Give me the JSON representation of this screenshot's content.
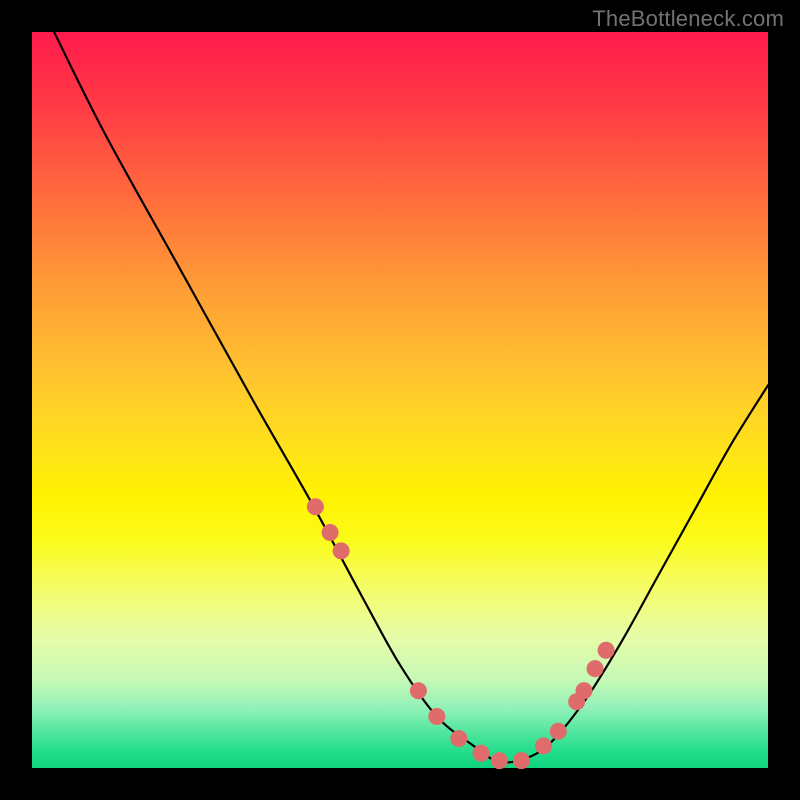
{
  "watermark": "TheBottleneck.com",
  "colors": {
    "frame": "#000000",
    "curve": "#000000",
    "dots": "#e06b6b",
    "watermark": "#737373"
  },
  "chart_data": {
    "type": "line",
    "title": "",
    "xlabel": "",
    "ylabel": "",
    "xlim": [
      0,
      100
    ],
    "ylim": [
      0,
      100
    ],
    "grid": false,
    "legend": false,
    "series": [
      {
        "name": "bottleneck-curve",
        "x": [
          3,
          10,
          20,
          30,
          38,
          45,
          50,
          55,
          60,
          63,
          66,
          70,
          75,
          80,
          85,
          90,
          95,
          100
        ],
        "y": [
          100,
          86,
          68,
          50,
          36,
          23,
          14,
          7,
          3,
          1,
          1,
          3,
          9,
          17,
          26,
          35,
          44,
          52
        ]
      }
    ],
    "dots": {
      "name": "highlight-dots",
      "x": [
        38.5,
        40.5,
        42,
        52.5,
        55,
        58,
        61,
        63.5,
        66.5,
        69.5,
        71.5,
        74,
        75,
        76.5,
        78
      ],
      "y": [
        35.5,
        32,
        29.5,
        10.5,
        7,
        4,
        2,
        1,
        1,
        3,
        5,
        9,
        10.5,
        13.5,
        16
      ]
    }
  }
}
